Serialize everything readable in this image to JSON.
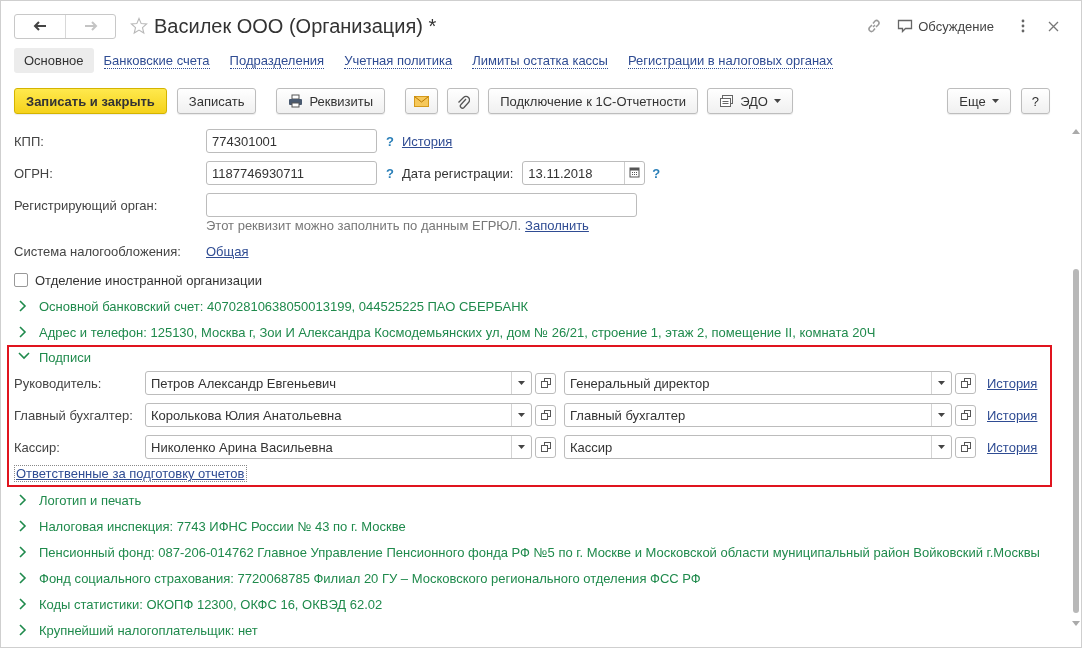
{
  "window": {
    "title": "Василек ООО (Организация) *",
    "nav": [
      {
        "kind": "back",
        "disabled": false
      },
      {
        "kind": "forward",
        "disabled": true
      }
    ],
    "favorite": false,
    "discussion": "Обсуждение"
  },
  "tabs": [
    {
      "label": "Основное",
      "selected": true
    },
    {
      "label": "Банковские счета",
      "selected": false
    },
    {
      "label": "Подразделения",
      "selected": false
    },
    {
      "label": "Учетная политика",
      "selected": false
    },
    {
      "label": "Лимиты остатка кассы",
      "selected": false
    },
    {
      "label": "Регистрации в налоговых органах",
      "selected": false
    }
  ],
  "toolbar": {
    "left": [
      {
        "kind": "primary",
        "label": "Записать и закрыть"
      },
      {
        "kind": "plain",
        "label": "Записать"
      },
      {
        "kind": "printer",
        "label": "Реквизиты"
      },
      {
        "kind": "mail"
      },
      {
        "kind": "clip"
      },
      {
        "kind": "plain",
        "label": "Подключение к 1С-Отчетности"
      },
      {
        "kind": "edo",
        "label": "ЭДО"
      }
    ],
    "right": [
      {
        "kind": "menu",
        "label": "Еще"
      },
      {
        "kind": "plain",
        "label": "?"
      }
    ]
  },
  "fields": {
    "kpp": {
      "label": "КПП:",
      "value": "774301001",
      "help": "?",
      "link": "История"
    },
    "ogrn": {
      "label": "ОГРН:",
      "value": "1187746930711",
      "help": "?"
    },
    "reg_date": {
      "label": "Дата регистрации:",
      "value": "13.11.2018",
      "help": "?"
    },
    "reg_body": {
      "label": "Регистрирующий орган:"
    },
    "hint": {
      "text": "Этот реквизит можно заполнить по данным ЕГРЮЛ.",
      "link": "Заполнить"
    },
    "tax_system": {
      "label": "Система налогообложения:",
      "link": "Общая"
    },
    "foreign_branch": {
      "label": "Отделение иностранной организации",
      "checked": false
    }
  },
  "sections": [
    {
      "title": "Основной банковский счет: 40702810638050013199, 044525225 ПАО СБЕРБАНК",
      "expanded": false,
      "highlighted": false
    },
    {
      "title": "Адрес и телефон: 125130, Москва г, Зои И Александра Космодемьянских ул, дом № 26/21, строение 1, этаж 2, помещение II, комната 20Ч",
      "expanded": false,
      "highlighted": false
    },
    {
      "title": "Подписи",
      "expanded": true,
      "highlighted": true,
      "rows": [
        {
          "label": "Руководитель:",
          "person": "Петров Александр Евгеньевич",
          "position": "Генеральный директор",
          "link": "История"
        },
        {
          "label": "Главный бухгалтер:",
          "person": "Королькова Юлия Анатольевна",
          "position": "Главный бухгалтер",
          "link": "История"
        },
        {
          "label": "Кассир:",
          "person": "Николенко Арина Васильевна",
          "position": "Кассир",
          "link": "История"
        }
      ],
      "link": "Ответственные за подготовку отчетов"
    },
    {
      "title": "Логотип и печать",
      "expanded": false,
      "highlighted": false
    },
    {
      "title": "Налоговая инспекция: 7743 ИФНС России № 43 по г. Москве",
      "expanded": false,
      "highlighted": false
    },
    {
      "title": "Пенсионный фонд: 087-206-014762 Главное Управление Пенсионного фонда РФ №5 по г. Москве и Московской области муниципальный район Войковский г.Москвы",
      "expanded": false,
      "highlighted": false
    },
    {
      "title": "Фонд социального страхования: 7720068785 Филиал 20 ГУ – Московского регионального отделения ФСС РФ",
      "expanded": false,
      "highlighted": false
    },
    {
      "title": "Коды статистики: ОКОПФ 12300, ОКФС 16, ОКВЭД 62.02",
      "expanded": false,
      "highlighted": false
    },
    {
      "title": "Крупнейший налогоплательщик: нет",
      "expanded": false,
      "highlighted": false
    }
  ]
}
